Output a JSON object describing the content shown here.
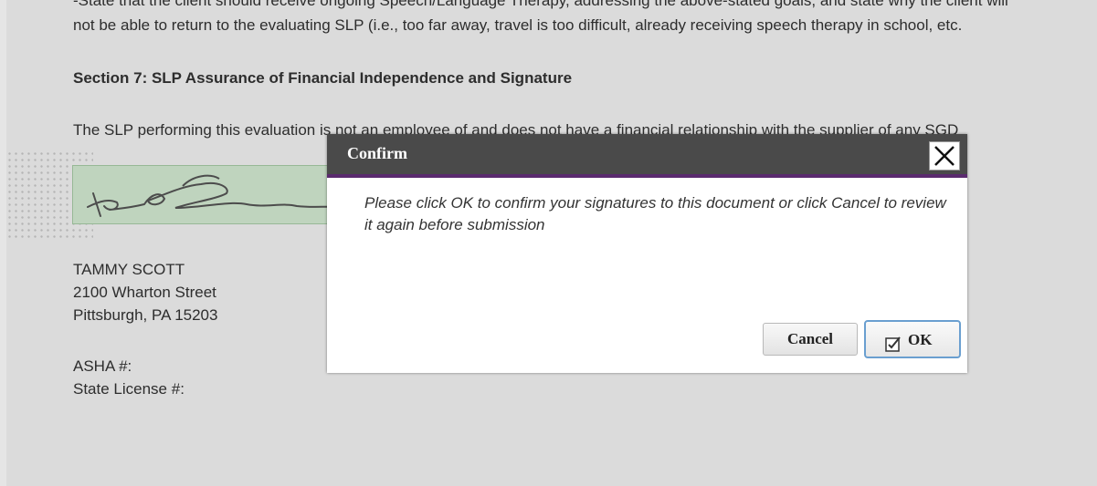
{
  "document": {
    "partial_top_line": "-State that the client should receive ongoing Speech/Language Therapy, addressing the above-stated goals, and state why the client will",
    "line2": "not be able to return to the evaluating SLP (i.e., too far away, travel is too difficult, already receiving speech therapy in school, etc.",
    "section_heading": "Section 7: SLP Assurance of Financial Independence and Signature",
    "statement": "The SLP performing this evaluation is not an employee of and does not have a financial relationship with the supplier of any SGD",
    "signer": {
      "name": "TAMMY SCOTT",
      "street": "2100 Wharton Street",
      "city": "Pittsburgh, PA 15203",
      "asha_label": "ASHA #:",
      "license_label": "State License #:"
    }
  },
  "dialog": {
    "title": "Confirm",
    "message": "Please click OK to confirm your signatures to this document or click Cancel to review it again before submission",
    "cancel_label": "Cancel",
    "ok_label": "OK",
    "ok_icon": "check-document-icon",
    "close_icon": "close-icon"
  },
  "colors": {
    "header_bg": "#4a4a4a",
    "header_accent": "#5a2a6e",
    "signature_bg": "#d5ecd4",
    "ok_border": "#6a9fd0"
  }
}
